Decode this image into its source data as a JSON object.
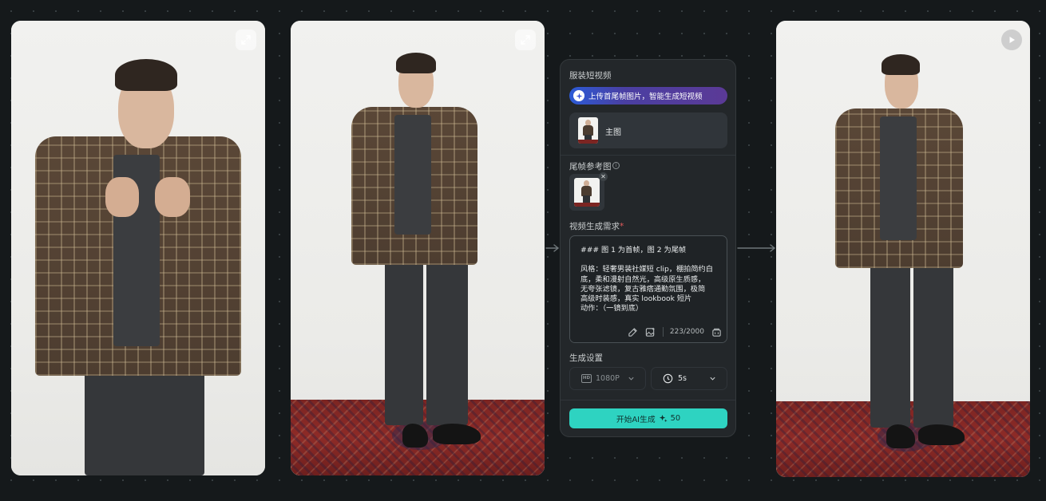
{
  "panel": {
    "title": "服装短视频",
    "upload_pill": "上传首尾帧图片，智能生成短视频",
    "main_image_label": "主图",
    "end_frame_label": "尾帧参考图",
    "video_req_label": "视频生成需求",
    "required_mark": "*",
    "prompt_lines": [
      "### 图 1 为首帧，图 2 为尾帧",
      "",
      "风格：轻奢男装社媒短 clip，棚拍简约白",
      "底，柔和漫射自然光，高级原生质感，",
      "无夸张滤镜，复古雅痞通勤氛围，极简",
      "高级时装感，真实 lookbook 短片",
      "动作：（一镜到底）"
    ],
    "char_count": "223/2000",
    "settings_label": "生成设置",
    "resolution_badge": "HD",
    "resolution_value": "1080P",
    "duration_value": "5s",
    "generate_label": "开始AI生成",
    "generate_cost": "50"
  },
  "icons": {
    "left_card_corner": "expand-icon",
    "middle_card_corner": "expand-icon",
    "right_card_corner": "play-icon",
    "pill_icon": "sparkle-icon",
    "info_icon": "info-icon",
    "clock_icon": "clock-icon",
    "generate_icon": "sparkle-icon"
  },
  "colors": {
    "canvas": "#15191b",
    "panel": "#23272a",
    "accent_button": "#2ed3c1",
    "pill_start": "#2c5bd7",
    "pill_end": "#5b3a96",
    "required": "#e35b5b"
  }
}
